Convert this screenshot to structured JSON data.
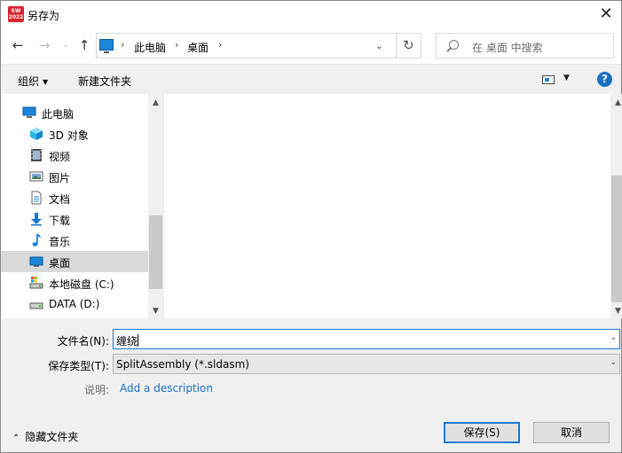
{
  "window": {
    "title": "另存为",
    "app_icon_text": "2022"
  },
  "nav": {
    "address_crumbs": [
      "此电脑",
      "桌面"
    ],
    "search_placeholder": "在 桌面 中搜索"
  },
  "toolbar": {
    "organize_label": "组织",
    "new_folder_label": "新建文件夹",
    "help_label": "?"
  },
  "sidebar": {
    "items": [
      {
        "label": "此电脑",
        "icon": "pc-icon"
      },
      {
        "label": "3D 对象",
        "icon": "3d-objects-icon"
      },
      {
        "label": "视频",
        "icon": "video-icon"
      },
      {
        "label": "图片",
        "icon": "pictures-icon"
      },
      {
        "label": "文档",
        "icon": "documents-icon"
      },
      {
        "label": "下载",
        "icon": "download-icon"
      },
      {
        "label": "音乐",
        "icon": "music-icon"
      },
      {
        "label": "桌面",
        "icon": "desktop-icon",
        "selected": true
      },
      {
        "label": "本地磁盘 (C:)",
        "icon": "local-disk-icon"
      },
      {
        "label": "DATA (D:)",
        "icon": "drive-icon"
      }
    ]
  },
  "form": {
    "filename_label": "文件名(N):",
    "filename_value": "缠绕",
    "filetype_label": "保存类型(T):",
    "filetype_value": "SplitAssembly (*.sldasm)",
    "description_label": "说明:",
    "description_link": "Add a description"
  },
  "footer": {
    "hide_folders_label": "隐藏文件夹",
    "save_label": "保存(S)",
    "cancel_label": "取消"
  },
  "colors": {
    "accent": "#1a76d2",
    "link": "#1a6fc4",
    "selected_bg": "#d9d9d9",
    "panel_bg": "#f0f0f0"
  }
}
